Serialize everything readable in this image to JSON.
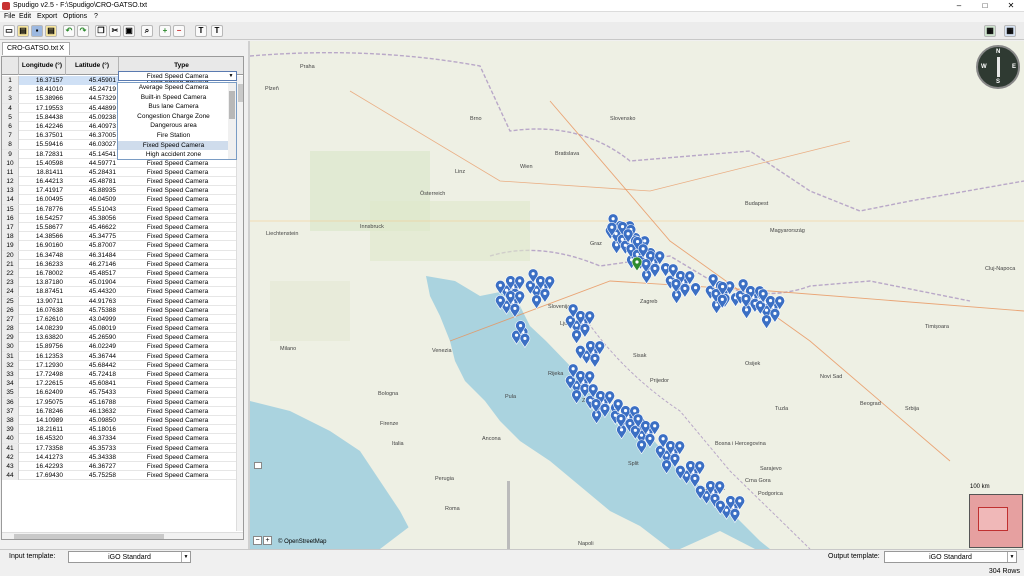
{
  "window": {
    "title": "Spudigo v2.5 - F:\\Spudigo\\CRO-GATSO.txt",
    "min": "–",
    "max": "□",
    "close": "✕"
  },
  "menu": [
    "File",
    "Edit",
    "Export",
    "Options",
    "?"
  ],
  "toolbar": {
    "text_t1": "T",
    "text_t2": "T"
  },
  "tab": {
    "label": "CRO-GATSO.txt",
    "close": "X"
  },
  "table": {
    "headers": [
      "",
      "Longitude (°)",
      "Latitude (°)",
      "Type"
    ],
    "rows": [
      [
        "1",
        "16.37157",
        "45.45901",
        "Fixed Speed Camera"
      ],
      [
        "2",
        "18.41010",
        "45.24719",
        ""
      ],
      [
        "3",
        "15.38966",
        "44.57329",
        ""
      ],
      [
        "4",
        "17.19553",
        "45.44899",
        ""
      ],
      [
        "5",
        "15.84438",
        "45.09238",
        ""
      ],
      [
        "6",
        "16.42246",
        "46.40973",
        ""
      ],
      [
        "7",
        "16.37501",
        "46.37005",
        ""
      ],
      [
        "8",
        "15.59416",
        "46.03027",
        ""
      ],
      [
        "9",
        "18.72831",
        "45.14541",
        "Fixed Speed Camera"
      ],
      [
        "10",
        "15.40598",
        "44.59771",
        "Fixed Speed Camera"
      ],
      [
        "11",
        "18.81411",
        "45.28431",
        "Fixed Speed Camera"
      ],
      [
        "12",
        "16.44213",
        "45.48781",
        "Fixed Speed Camera"
      ],
      [
        "13",
        "17.41917",
        "45.88935",
        "Fixed Speed Camera"
      ],
      [
        "14",
        "16.00495",
        "46.04509",
        "Fixed Speed Camera"
      ],
      [
        "15",
        "16.78776",
        "45.51043",
        "Fixed Speed Camera"
      ],
      [
        "16",
        "16.54257",
        "45.38056",
        "Fixed Speed Camera"
      ],
      [
        "17",
        "15.58677",
        "45.46622",
        "Fixed Speed Camera"
      ],
      [
        "18",
        "14.38566",
        "45.34775",
        "Fixed Speed Camera"
      ],
      [
        "19",
        "16.90160",
        "45.87007",
        "Fixed Speed Camera"
      ],
      [
        "20",
        "16.34748",
        "46.31484",
        "Fixed Speed Camera"
      ],
      [
        "21",
        "16.36233",
        "46.27146",
        "Fixed Speed Camera"
      ],
      [
        "22",
        "16.78002",
        "45.48517",
        "Fixed Speed Camera"
      ],
      [
        "23",
        "13.87180",
        "45.01904",
        "Fixed Speed Camera"
      ],
      [
        "24",
        "18.87451",
        "45.44320",
        "Fixed Speed Camera"
      ],
      [
        "25",
        "13.90711",
        "44.91763",
        "Fixed Speed Camera"
      ],
      [
        "26",
        "16.07638",
        "45.75388",
        "Fixed Speed Camera"
      ],
      [
        "27",
        "17.62610",
        "43.04999",
        "Fixed Speed Camera"
      ],
      [
        "28",
        "14.08239",
        "45.08019",
        "Fixed Speed Camera"
      ],
      [
        "29",
        "13.63820",
        "45.26590",
        "Fixed Speed Camera"
      ],
      [
        "30",
        "15.89756",
        "46.02249",
        "Fixed Speed Camera"
      ],
      [
        "31",
        "16.12353",
        "45.36744",
        "Fixed Speed Camera"
      ],
      [
        "32",
        "17.12930",
        "45.68442",
        "Fixed Speed Camera"
      ],
      [
        "33",
        "17.72498",
        "45.72418",
        "Fixed Speed Camera"
      ],
      [
        "34",
        "17.22615",
        "45.60841",
        "Fixed Speed Camera"
      ],
      [
        "35",
        "16.62409",
        "45.75433",
        "Fixed Speed Camera"
      ],
      [
        "36",
        "17.95075",
        "45.16788",
        "Fixed Speed Camera"
      ],
      [
        "37",
        "16.78246",
        "46.13632",
        "Fixed Speed Camera"
      ],
      [
        "38",
        "14.10989",
        "45.09850",
        "Fixed Speed Camera"
      ],
      [
        "39",
        "18.21611",
        "45.18016",
        "Fixed Speed Camera"
      ],
      [
        "40",
        "16.45320",
        "46.37334",
        "Fixed Speed Camera"
      ],
      [
        "41",
        "17.73358",
        "45.35733",
        "Fixed Speed Camera"
      ],
      [
        "42",
        "14.41273",
        "45.34338",
        "Fixed Speed Camera"
      ],
      [
        "43",
        "16.42293",
        "46.36727",
        "Fixed Speed Camera"
      ],
      [
        "44",
        "17.69430",
        "45.75258",
        "Fixed Speed Camera"
      ]
    ],
    "selected_type": "Fixed Speed Camera",
    "dropdown_options": [
      "Average Speed Camera",
      "Built-in Speed Camera",
      "Bus lane Camera",
      "Congestion Charge Zone",
      "Dangerous area",
      "Fire Station",
      "Fixed Speed Camera",
      "High accident zone"
    ],
    "dropdown_active": "Fixed Speed Camera"
  },
  "map": {
    "attribution": "© OpenStreetMap",
    "scale": "100 km",
    "compass": {
      "n": "N",
      "e": "E",
      "s": "S",
      "w": "W"
    },
    "zoom_in": "+",
    "zoom_out": "−",
    "colors": {
      "sea": "#aad3df",
      "land": "#eef0e4",
      "marker": "#3b6fc4",
      "marker_active": "#2e8b2e"
    },
    "labels": [
      [
        "Praha",
        300,
        8
      ],
      [
        "Plzeň",
        265,
        30
      ],
      [
        "Brno",
        470,
        60
      ],
      [
        "Slovensko",
        610,
        60
      ],
      [
        "Bratislava",
        555,
        95
      ],
      [
        "Österreich",
        420,
        135
      ],
      [
        "Budapest",
        745,
        145
      ],
      [
        "Magyarország",
        770,
        172
      ],
      [
        "Graz",
        590,
        185
      ],
      [
        "Wien",
        520,
        108
      ],
      [
        "Linz",
        455,
        113
      ],
      [
        "Innsbruck",
        360,
        168
      ],
      [
        "Liechtenstein",
        266,
        175
      ],
      [
        "Slovenija",
        548,
        248
      ],
      [
        "Ljubljana",
        560,
        265
      ],
      [
        "Zagreb",
        640,
        243
      ],
      [
        "Timișoara",
        925,
        268
      ],
      [
        "Venezia",
        432,
        292
      ],
      [
        "Milano",
        280,
        290
      ],
      [
        "Bologna",
        378,
        335
      ],
      [
        "Firenze",
        380,
        365
      ],
      [
        "Italia",
        392,
        385
      ],
      [
        "Roma",
        445,
        450
      ],
      [
        "Srbija",
        905,
        350
      ],
      [
        "Beograd",
        860,
        345
      ],
      [
        "Novi Sad",
        820,
        318
      ],
      [
        "Bosna i Hercegovina",
        715,
        385
      ],
      [
        "Sarajevo",
        760,
        410
      ],
      [
        "Crna Gora",
        745,
        482
      ],
      [
        "Podgorica",
        758,
        495
      ],
      [
        "Sofia",
        980,
        445
      ],
      [
        "Split",
        628,
        405
      ],
      [
        "Zadar",
        582,
        342
      ],
      [
        "Rijeka",
        548,
        315
      ],
      [
        "Pula",
        505,
        338
      ],
      [
        "Dubrovnik",
        700,
        490
      ],
      [
        "Osijek",
        745,
        305
      ],
      [
        "Sisak",
        633,
        297
      ],
      [
        "Prijedor",
        650,
        322
      ],
      [
        "Tuzla",
        775,
        350
      ],
      [
        "Mostar",
        700,
        432
      ],
      [
        "Napoli",
        578,
        545
      ],
      [
        "Ancona",
        482,
        380
      ],
      [
        "Perugia",
        435,
        420
      ],
      [
        "Cluj-Napoca",
        985,
        210
      ]
    ]
  },
  "status": {
    "input_label": "Input template:",
    "input_value": "iGO Standard",
    "output_label": "Output template:",
    "output_value": "iGO Standard",
    "rows": "304 Rows"
  }
}
